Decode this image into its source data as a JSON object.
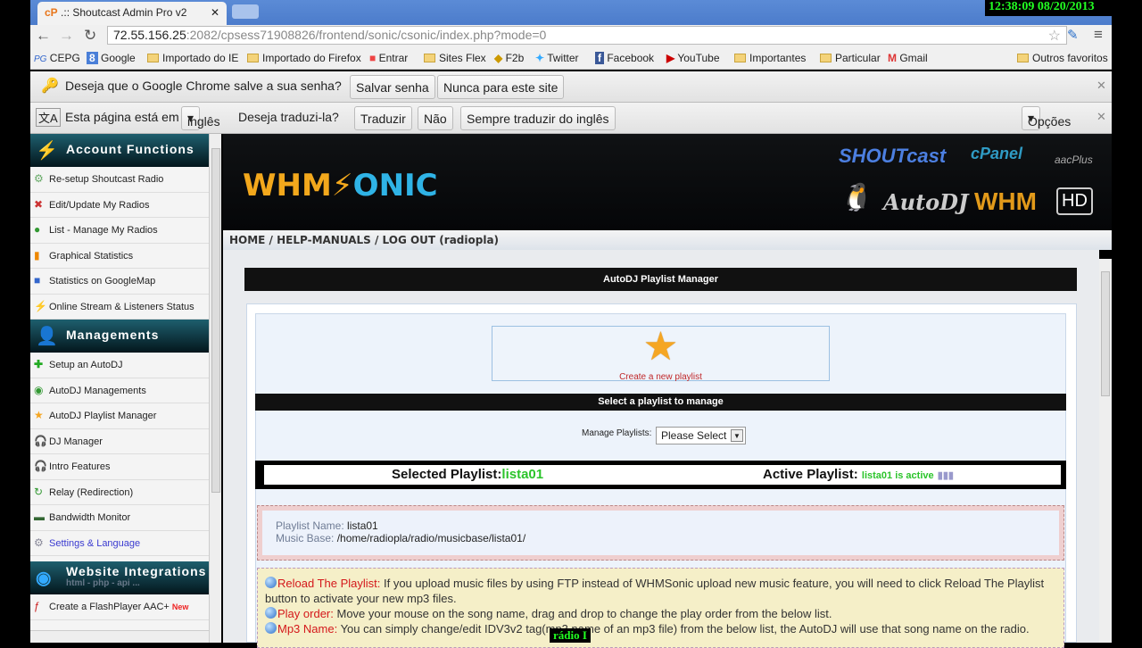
{
  "browser": {
    "tab_title": ".:: Shoutcast Admin Pro v2",
    "tab_favicon": "cP",
    "clock": "12:38:09  08/20/2013",
    "url_host": "72.55.156.25",
    "url_rest": ":2082/cpsess71908826/frontend/sonic/csonic/index.php?mode=0",
    "bookmarks": [
      "CEPG",
      "Google",
      "Importado do IE",
      "Importado do Firefox",
      "Entrar",
      "Sites Flex",
      "F2b",
      "Twitter",
      "Facebook",
      "YouTube",
      "Importantes",
      "Particular",
      "Gmail"
    ],
    "other_bookmarks": "Outros favoritos",
    "password_bar": {
      "text": "Deseja que o Google Chrome salve a sua senha?",
      "save": "Salvar senha",
      "never": "Nunca para este site"
    },
    "translate_bar": {
      "text": "Esta página está em",
      "language": "inglês",
      "question": "Deseja traduzi-la?",
      "translate": "Traduzir",
      "no": "Não",
      "always": "Sempre traduzir do inglês",
      "options": "Opções"
    }
  },
  "sidebar": {
    "sections": [
      {
        "title": "Account Functions",
        "items": [
          "Re-setup Shoutcast Radio",
          "Edit/Update My Radios",
          "List - Manage My Radios",
          "Graphical Statistics",
          "Statistics on GoogleMap",
          "Online Stream & Listeners Status"
        ]
      },
      {
        "title": "Managements",
        "items": [
          "Setup an AutoDJ",
          "AutoDJ Managements",
          "AutoDJ Playlist Manager",
          "DJ Manager",
          "Intro Features",
          "Relay (Redirection)",
          "Bandwidth Monitor",
          "Settings & Language"
        ]
      },
      {
        "title": "Website Integrations",
        "subtitle": "html - php - api ...",
        "items": [
          "Create a FlashPlayer AAC+"
        ],
        "new_badge": "New"
      }
    ]
  },
  "header": {
    "logo_left": "WHM",
    "logo_right": "ONIC",
    "brands": [
      "SHOUTcast",
      "cPanel",
      "aacPlus",
      "AutoDJ",
      "WHM",
      "HD"
    ],
    "breadcrumb": "HOME / HELP-MANUALS / LOG OUT (radiopla)"
  },
  "main": {
    "title": "AutoDJ Playlist Manager",
    "create_label": "Create a new playlist",
    "select_title": "Select a playlist to manage",
    "manage_label": "Manage Playlists:",
    "manage_value": "Please Select",
    "selected_label": "Selected Playlist:",
    "selected_value": "lista01",
    "active_label": "Active Playlist:",
    "active_value": "lista01 is active",
    "playlist_name_label": "Playlist Name:",
    "playlist_name": "lista01",
    "music_base_label": "Music Base:",
    "music_base": "/home/radiopla/radio/musicbase/lista01/",
    "tips": [
      {
        "title": "Reload The Playlist:",
        "text": " If you upload music files by using FTP instead of WHMSonic upload new music feature, you will need to click Reload The Playlist button to activate your new mp3 files."
      },
      {
        "title": "Play order:",
        "text": " Move your mouse on the song name, drag and drop to change the play order from the below list."
      },
      {
        "title": "Mp3 Name:",
        "text": " You can simply change/edit IDV3v2 tag(mp3 name of an mp3 file) from the below list, the AutoDJ will use that song name on the radio."
      }
    ]
  },
  "overlay": "rádio I"
}
